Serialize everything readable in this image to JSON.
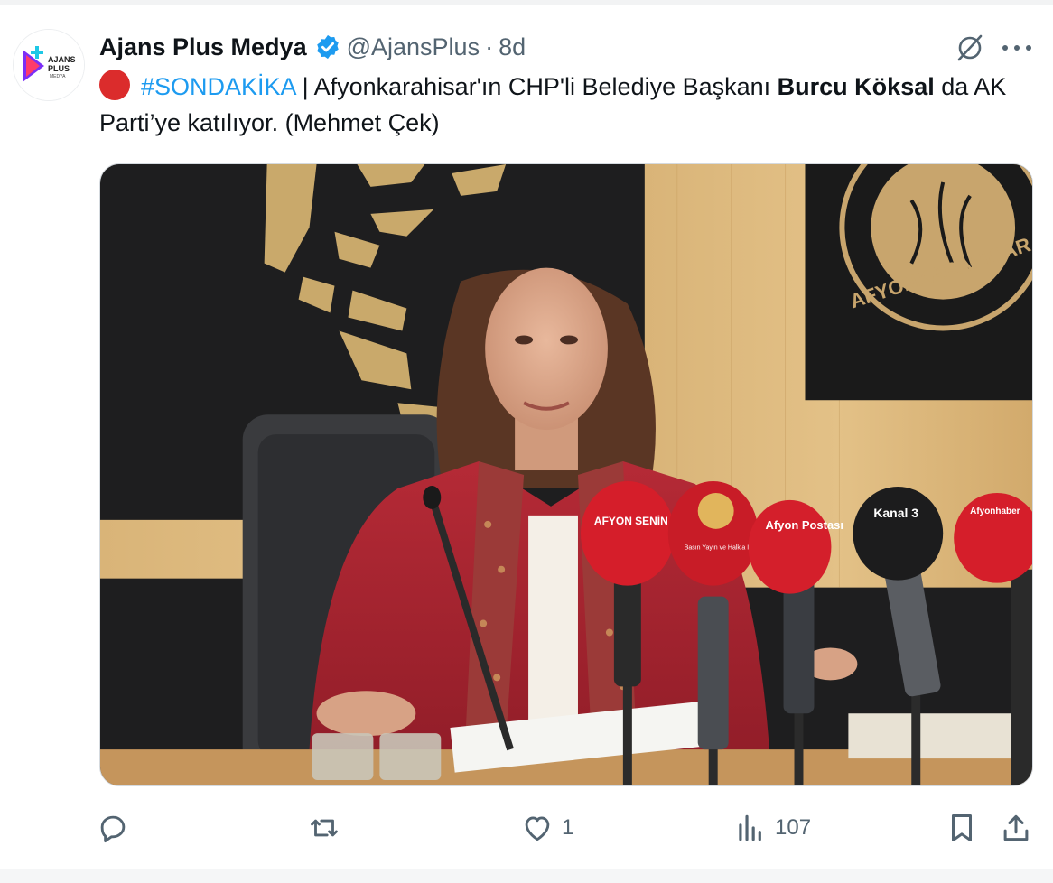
{
  "tweet": {
    "author_name": "Ajans Plus Medya",
    "handle": "@AjansPlus",
    "separator": "·",
    "time": "8d",
    "hashtag": "#SONDAKİKA",
    "text_part1": " | Afyonkarahisar'ın CHP'li Belediye Başkanı ",
    "bold_name": "Burcu Köksal",
    "text_part2": " da AK Parti’ye katılıyor. (Mehmet Çek)"
  },
  "avatar": {
    "logo_line1": "AJANS",
    "logo_line2": "PLUS",
    "logo_line3": "MEDYA"
  },
  "media": {
    "emblem_text": "AFYONKARAHISAR BELEDİYESİ",
    "mic_labels": [
      "AFYON SENİN WEB TV",
      "Basın Yayın ve Halkla İlişkiler Müdürlüğü",
      "Afyon Postası",
      "Kanal 3",
      "Afyonhaber"
    ]
  },
  "actions": {
    "reply_count": "",
    "retweet_count": "",
    "like_count": "1",
    "views_count": "107"
  },
  "icons": {
    "verified": "verified-badge-icon",
    "grok": "grok-icon",
    "more": "more-icon",
    "reply": "reply-icon",
    "retweet": "retweet-icon",
    "like": "like-icon",
    "views": "views-icon",
    "bookmark": "bookmark-icon",
    "share": "share-icon"
  },
  "colors": {
    "accent": "#1d9bf0",
    "muted": "#536471",
    "text": "#0f1419",
    "alert_red": "#db2c2c"
  }
}
